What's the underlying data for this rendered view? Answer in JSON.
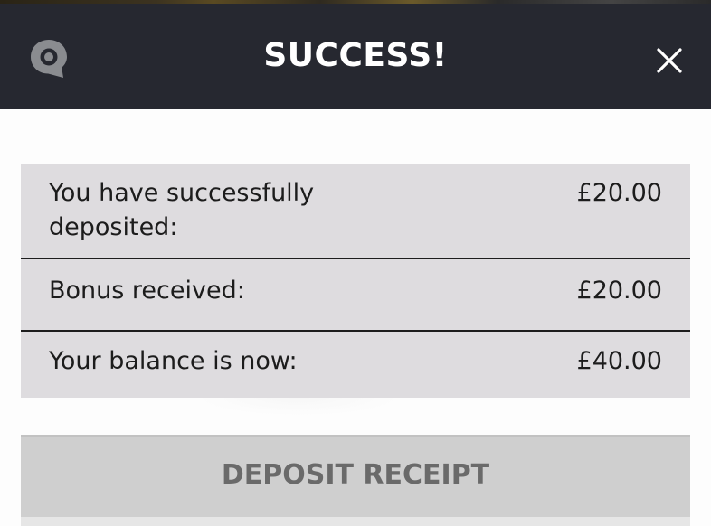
{
  "header": {
    "title": "SUCCESS!",
    "logo_icon": "chat-bubble-logo-icon",
    "close_icon": "close-icon",
    "background_color": "#262830",
    "title_color": "#ffffff"
  },
  "summary": {
    "rows": [
      {
        "label": "You have successfully deposited:",
        "value": "£20.00"
      },
      {
        "label": "Bonus received:",
        "value": "£20.00"
      },
      {
        "label": "Your balance is now:",
        "value": "£40.00"
      }
    ],
    "background_color": "#dedcdf"
  },
  "actions": {
    "receipt_label": "DEPOSIT RECEIPT",
    "receipt_background": "#cfcfcf",
    "receipt_text_color": "#6a6a6a"
  }
}
